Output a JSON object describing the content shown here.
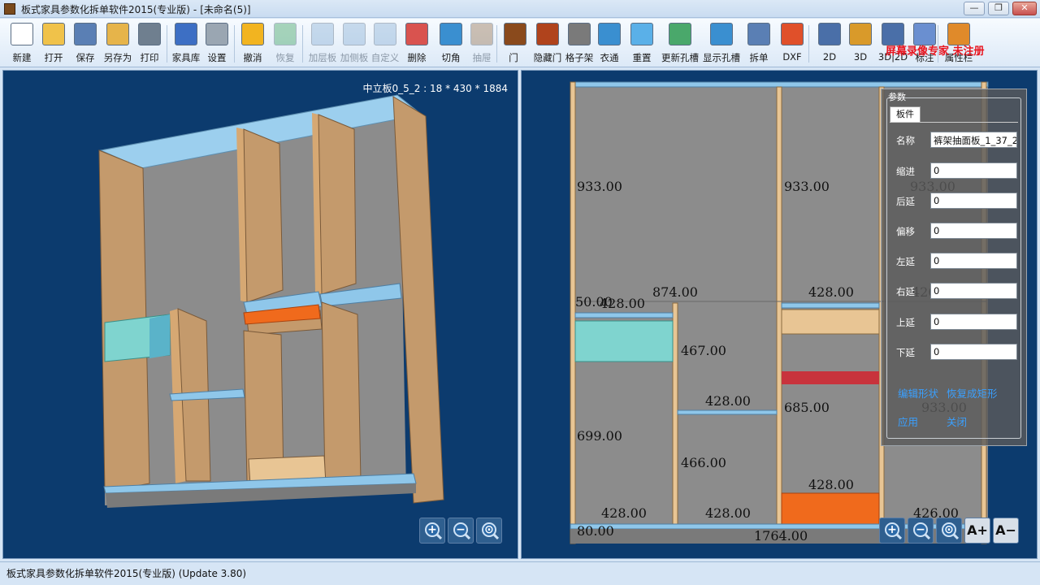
{
  "window": {
    "app_title": "板式家具参数化拆单软件2015(专业版)",
    "separator": "-",
    "doc_title": "[未命名(5)]",
    "buttons": {
      "minimize": "—",
      "restore": "❐",
      "close": "✕"
    }
  },
  "toolbar": {
    "items": [
      {
        "label": "新建",
        "icon": "new-file-icon",
        "enabled": true
      },
      {
        "label": "打开",
        "icon": "folder-open-icon",
        "enabled": true
      },
      {
        "label": "保存",
        "icon": "save-icon",
        "enabled": true
      },
      {
        "label": "另存为",
        "icon": "save-as-icon",
        "enabled": true
      },
      {
        "label": "打印",
        "icon": "printer-icon",
        "enabled": true
      },
      {
        "label": "家具库",
        "icon": "library-grid-icon",
        "enabled": true
      },
      {
        "label": "设置",
        "icon": "gear-icon",
        "enabled": true
      },
      {
        "label": "撤消",
        "icon": "undo-icon",
        "enabled": true
      },
      {
        "label": "恢复",
        "icon": "redo-icon",
        "enabled": false
      },
      {
        "label": "加层板",
        "icon": "add-shelf-icon",
        "enabled": false
      },
      {
        "label": "加侧板",
        "icon": "add-side-panel-icon",
        "enabled": false
      },
      {
        "label": "自定义",
        "icon": "custom-panel-icon",
        "enabled": false
      },
      {
        "label": "删除",
        "icon": "delete-icon",
        "enabled": true
      },
      {
        "label": "切角",
        "icon": "chamfer-icon",
        "enabled": true
      },
      {
        "label": "抽屉",
        "icon": "drawer-icon",
        "enabled": false
      },
      {
        "label": "门",
        "icon": "door-icon",
        "enabled": true
      },
      {
        "label": "隐藏门",
        "icon": "hide-door-icon",
        "enabled": true
      },
      {
        "label": "格子架",
        "icon": "grid-rack-icon",
        "enabled": true
      },
      {
        "label": "衣通",
        "icon": "hanging-rod-icon",
        "enabled": true
      },
      {
        "label": "重置",
        "icon": "reset-icon",
        "enabled": true
      },
      {
        "label": "更新孔槽",
        "icon": "update-holes-icon",
        "enabled": true
      },
      {
        "label": "显示孔槽",
        "icon": "show-holes-icon",
        "enabled": true
      },
      {
        "label": "拆单",
        "icon": "split-order-icon",
        "enabled": true
      },
      {
        "label": "DXF",
        "icon": "dxf-icon",
        "enabled": true
      },
      {
        "label": "2D",
        "icon": "view-2d-icon",
        "enabled": true
      },
      {
        "label": "3D",
        "icon": "view-3d-icon",
        "enabled": true
      },
      {
        "label": "3D|2D",
        "icon": "view-split-icon",
        "enabled": true
      },
      {
        "label": "标注",
        "icon": "dimension-icon",
        "enabled": true
      },
      {
        "label": "属性栏",
        "icon": "properties-icon",
        "enabled": true
      }
    ],
    "watermark": "屏幕录像专家  未注册"
  },
  "view3d": {
    "selected_info": "中立板0_5_2 : 18 * 430 * 1884"
  },
  "view2d": {
    "dimensions": [
      "933.00",
      "933.00",
      "933.00",
      "50.00",
      "428.00",
      "874.00",
      "428.00",
      "426.00",
      "467.00",
      "428.00",
      "685.00",
      "933.00",
      "699.00",
      "466.00",
      "428.00",
      "428.00",
      "428.00",
      "426.00",
      "80.00",
      "1764.00"
    ]
  },
  "param_panel": {
    "legend": "参数",
    "tab": "板件",
    "fields": [
      {
        "label": "名称",
        "value": "裤架抽面板_1_37_2"
      },
      {
        "label": "缩进",
        "value": "0"
      },
      {
        "label": "后延",
        "value": "0"
      },
      {
        "label": "偏移",
        "value": "0"
      },
      {
        "label": "左延",
        "value": "0"
      },
      {
        "label": "右延",
        "value": "0"
      },
      {
        "label": "上延",
        "value": "0"
      },
      {
        "label": "下延",
        "value": "0"
      }
    ],
    "edit_shape": "编辑形状",
    "restore_rect": "恢复成矩形",
    "apply": "应用",
    "close": "关闭"
  },
  "zoom": {
    "in": "+",
    "out": "−",
    "fit": "⊙",
    "font_up": "A+",
    "font_down": "A−"
  },
  "status": "板式家具参数化拆单软件2015(专业版) (Update 3.80)",
  "colors": {
    "view_background": "#0c3b6e",
    "panel_wood": "#c49a6c",
    "panel_blue": "#8fc7ea",
    "drawer_teal": "#7fd4cf",
    "accent_orange": "#f06a1c",
    "accent_red": "#c8333c",
    "watermark_red": "#e8141e"
  }
}
